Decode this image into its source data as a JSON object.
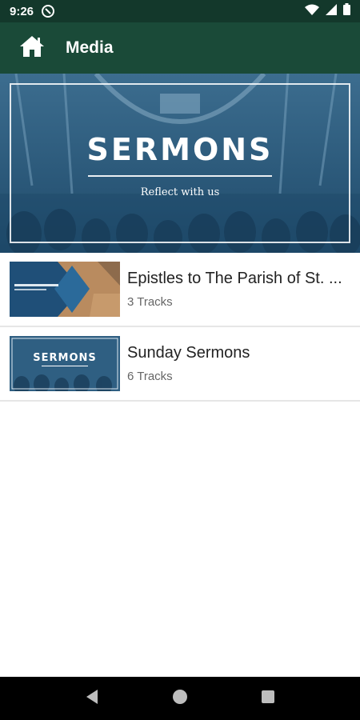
{
  "status_bar": {
    "time": "9:26"
  },
  "app_bar": {
    "title": "Media"
  },
  "banner": {
    "title": "SERMONS",
    "subtitle": "Reflect with us"
  },
  "media": [
    {
      "title": "Epistles to The Parish of St. ...",
      "subtitle": "3 Tracks"
    },
    {
      "title": "Sunday Sermons",
      "subtitle": "6 Tracks",
      "thumb_label": "SERMONS"
    }
  ],
  "colors": {
    "status_bar": "#13382b",
    "app_bar": "#1a4a38",
    "banner_tint": "#27577a"
  }
}
